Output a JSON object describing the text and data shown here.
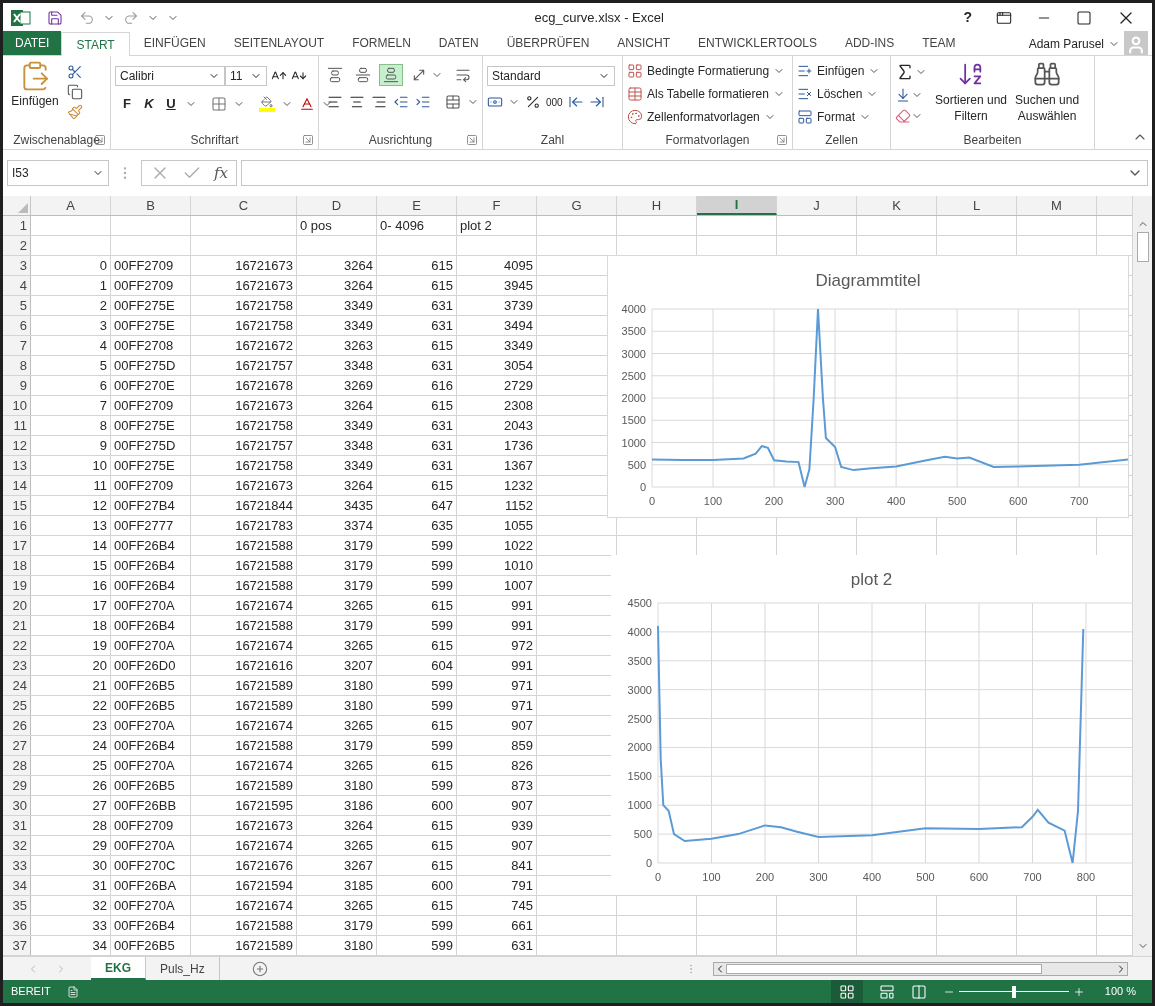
{
  "title_bar": {
    "title": "ecg_curve.xlsx - Excel",
    "help": "?"
  },
  "ribbon_tabs": [
    {
      "label": "DATEI",
      "kind": "file",
      "selected": false
    },
    {
      "label": "START",
      "kind": "tab",
      "selected": true
    },
    {
      "label": "EINFÜGEN",
      "kind": "tab",
      "selected": false
    },
    {
      "label": "SEITENLAYOUT",
      "kind": "tab",
      "selected": false
    },
    {
      "label": "FORMELN",
      "kind": "tab",
      "selected": false
    },
    {
      "label": "DATEN",
      "kind": "tab",
      "selected": false
    },
    {
      "label": "ÜBERPRÜFEN",
      "kind": "tab",
      "selected": false
    },
    {
      "label": "ANSICHT",
      "kind": "tab",
      "selected": false
    },
    {
      "label": "ENTWICKLERTOOLS",
      "kind": "tab",
      "selected": false
    },
    {
      "label": "ADD-INS",
      "kind": "tab",
      "selected": false
    },
    {
      "label": "TEAM",
      "kind": "tab",
      "selected": false
    }
  ],
  "user": {
    "name": "Adam Parusel"
  },
  "ribbon": {
    "clipboard": {
      "paste": "Einfügen",
      "label": "Zwischenablage"
    },
    "font": {
      "name": "Calibri",
      "size": "11",
      "bold": "F",
      "italic": "K",
      "underline": "U",
      "label": "Schriftart"
    },
    "alignment": {
      "vertical": [
        {
          "kind": "top",
          "selected": false
        },
        {
          "kind": "middle",
          "selected": false
        },
        {
          "kind": "bottom",
          "selected": true
        }
      ],
      "label": "Ausrichtung"
    },
    "number": {
      "format": "Standard",
      "thousands": "000",
      "label": "Zahl"
    },
    "styles": {
      "items": [
        "Bedingte Formatierung",
        "Als Tabelle formatieren",
        "Zellenformatvorlagen"
      ],
      "label": "Formatvorlagen"
    },
    "cells": {
      "items": [
        "Einfügen",
        "Löschen",
        "Format"
      ],
      "label": "Zellen"
    },
    "editing": {
      "sort": [
        "Sortieren und",
        "Filtern"
      ],
      "find": [
        "Suchen und",
        "Auswählen"
      ],
      "label": "Bearbeiten"
    }
  },
  "formula_bar": {
    "name_box": "I53",
    "fx": "fx"
  },
  "sheet": {
    "columns": [
      {
        "label": "A",
        "selected": false
      },
      {
        "label": "B",
        "selected": false
      },
      {
        "label": "C",
        "selected": false
      },
      {
        "label": "D",
        "selected": false
      },
      {
        "label": "E",
        "selected": false
      },
      {
        "label": "F",
        "selected": false
      },
      {
        "label": "G",
        "selected": false
      },
      {
        "label": "H",
        "selected": false
      },
      {
        "label": "I",
        "selected": true
      },
      {
        "label": "J",
        "selected": false
      },
      {
        "label": "K",
        "selected": false
      },
      {
        "label": "L",
        "selected": false
      },
      {
        "label": "M",
        "selected": false
      }
    ],
    "rows": [
      {
        "number": "1",
        "kind": "labels",
        "column_d": "0 pos",
        "column_e": "0- 4096",
        "column_f": "plot 2"
      },
      {
        "number": "2",
        "kind": "empty"
      },
      {
        "number": "3",
        "kind": "data",
        "cells": [
          "0",
          "00FF2709",
          "16721673",
          "3264",
          "615",
          "4095"
        ]
      },
      {
        "number": "4",
        "kind": "data",
        "cells": [
          "1",
          "00FF2709",
          "16721673",
          "3264",
          "615",
          "3945"
        ]
      },
      {
        "number": "5",
        "kind": "data",
        "cells": [
          "2",
          "00FF275E",
          "16721758",
          "3349",
          "631",
          "3739"
        ]
      },
      {
        "number": "6",
        "kind": "data",
        "cells": [
          "3",
          "00FF275E",
          "16721758",
          "3349",
          "631",
          "3494"
        ]
      },
      {
        "number": "7",
        "kind": "data",
        "cells": [
          "4",
          "00FF2708",
          "16721672",
          "3263",
          "615",
          "3349"
        ]
      },
      {
        "number": "8",
        "kind": "data",
        "cells": [
          "5",
          "00FF275D",
          "16721757",
          "3348",
          "631",
          "3054"
        ]
      },
      {
        "number": "9",
        "kind": "data",
        "cells": [
          "6",
          "00FF270E",
          "16721678",
          "3269",
          "616",
          "2729"
        ]
      },
      {
        "number": "10",
        "kind": "data",
        "cells": [
          "7",
          "00FF2709",
          "16721673",
          "3264",
          "615",
          "2308"
        ]
      },
      {
        "number": "11",
        "kind": "data",
        "cells": [
          "8",
          "00FF275E",
          "16721758",
          "3349",
          "631",
          "2043"
        ]
      },
      {
        "number": "12",
        "kind": "data",
        "cells": [
          "9",
          "00FF275D",
          "16721757",
          "3348",
          "631",
          "1736"
        ]
      },
      {
        "number": "13",
        "kind": "data",
        "cells": [
          "10",
          "00FF275E",
          "16721758",
          "3349",
          "631",
          "1367"
        ]
      },
      {
        "number": "14",
        "kind": "data",
        "cells": [
          "11",
          "00FF2709",
          "16721673",
          "3264",
          "615",
          "1232"
        ]
      },
      {
        "number": "15",
        "kind": "data",
        "cells": [
          "12",
          "00FF27B4",
          "16721844",
          "3435",
          "647",
          "1152"
        ]
      },
      {
        "number": "16",
        "kind": "data",
        "cells": [
          "13",
          "00FF2777",
          "16721783",
          "3374",
          "635",
          "1055"
        ]
      },
      {
        "number": "17",
        "kind": "data",
        "cells": [
          "14",
          "00FF26B4",
          "16721588",
          "3179",
          "599",
          "1022"
        ]
      },
      {
        "number": "18",
        "kind": "data",
        "cells": [
          "15",
          "00FF26B4",
          "16721588",
          "3179",
          "599",
          "1010"
        ]
      },
      {
        "number": "19",
        "kind": "data",
        "cells": [
          "16",
          "00FF26B4",
          "16721588",
          "3179",
          "599",
          "1007"
        ]
      },
      {
        "number": "20",
        "kind": "data",
        "cells": [
          "17",
          "00FF270A",
          "16721674",
          "3265",
          "615",
          "991"
        ]
      },
      {
        "number": "21",
        "kind": "data",
        "cells": [
          "18",
          "00FF26B4",
          "16721588",
          "3179",
          "599",
          "991"
        ]
      },
      {
        "number": "22",
        "kind": "data",
        "cells": [
          "19",
          "00FF270A",
          "16721674",
          "3265",
          "615",
          "972"
        ]
      },
      {
        "number": "23",
        "kind": "data",
        "cells": [
          "20",
          "00FF26D0",
          "16721616",
          "3207",
          "604",
          "991"
        ]
      },
      {
        "number": "24",
        "kind": "data",
        "cells": [
          "21",
          "00FF26B5",
          "16721589",
          "3180",
          "599",
          "971"
        ]
      },
      {
        "number": "25",
        "kind": "data",
        "cells": [
          "22",
          "00FF26B5",
          "16721589",
          "3180",
          "599",
          "971"
        ]
      },
      {
        "number": "26",
        "kind": "data",
        "cells": [
          "23",
          "00FF270A",
          "16721674",
          "3265",
          "615",
          "907"
        ]
      },
      {
        "number": "27",
        "kind": "data",
        "cells": [
          "24",
          "00FF26B4",
          "16721588",
          "3179",
          "599",
          "859"
        ]
      },
      {
        "number": "28",
        "kind": "data",
        "cells": [
          "25",
          "00FF270A",
          "16721674",
          "3265",
          "615",
          "826"
        ]
      },
      {
        "number": "29",
        "kind": "data",
        "cells": [
          "26",
          "00FF26B5",
          "16721589",
          "3180",
          "599",
          "873"
        ]
      },
      {
        "number": "30",
        "kind": "data",
        "cells": [
          "27",
          "00FF26BB",
          "16721595",
          "3186",
          "600",
          "907"
        ]
      },
      {
        "number": "31",
        "kind": "data",
        "cells": [
          "28",
          "00FF2709",
          "16721673",
          "3264",
          "615",
          "939"
        ]
      },
      {
        "number": "32",
        "kind": "data",
        "cells": [
          "29",
          "00FF270A",
          "16721674",
          "3265",
          "615",
          "907"
        ]
      },
      {
        "number": "33",
        "kind": "data",
        "cells": [
          "30",
          "00FF270C",
          "16721676",
          "3267",
          "615",
          "841"
        ]
      },
      {
        "number": "34",
        "kind": "data",
        "cells": [
          "31",
          "00FF26BA",
          "16721594",
          "3185",
          "600",
          "791"
        ]
      },
      {
        "number": "35",
        "kind": "data",
        "cells": [
          "32",
          "00FF270A",
          "16721674",
          "3265",
          "615",
          "745"
        ]
      },
      {
        "number": "36",
        "kind": "data",
        "cells": [
          "33",
          "00FF26B4",
          "16721588",
          "3179",
          "599",
          "661"
        ]
      },
      {
        "number": "37",
        "kind": "data",
        "cells": [
          "34",
          "00FF26B5",
          "16721589",
          "3180",
          "599",
          "631"
        ]
      }
    ],
    "charts": [
      {
        "chart_data": {
          "type": "line",
          "title": "Diagrammtitel",
          "grid": true,
          "xlim": [
            0,
            780
          ],
          "ylim": [
            0,
            4000
          ],
          "xticks": [
            0,
            100,
            200,
            300,
            400,
            500,
            600,
            700
          ],
          "yticks": [
            0,
            500,
            1000,
            1500,
            2000,
            2500,
            3000,
            3500,
            4000
          ],
          "x": [
            0,
            50,
            100,
            150,
            170,
            180,
            190,
            200,
            220,
            240,
            250,
            258,
            265,
            272,
            280,
            285,
            300,
            310,
            330,
            360,
            400,
            450,
            480,
            500,
            520,
            560,
            600,
            700,
            780
          ],
          "series": [
            {
              "color": "#5b9bd5",
              "values": [
                620,
                610,
                610,
                640,
                750,
                920,
                880,
                600,
                570,
                560,
                0,
                400,
                2000,
                4000,
                2000,
                1100,
                900,
                450,
                380,
                420,
                460,
                600,
                680,
                640,
                660,
                450,
                460,
                500,
                620
              ]
            }
          ]
        }
      },
      {
        "chart_data": {
          "type": "line",
          "title": "plot 2",
          "grid": true,
          "xlim": [
            0,
            886
          ],
          "ylim": [
            0,
            4500
          ],
          "xticks": [
            0,
            100,
            200,
            300,
            400,
            500,
            600,
            700,
            800
          ],
          "yticks": [
            0,
            500,
            1000,
            1500,
            2000,
            2500,
            3000,
            3500,
            4000,
            4500
          ],
          "x": [
            0,
            5,
            10,
            20,
            30,
            50,
            100,
            150,
            200,
            230,
            260,
            300,
            400,
            500,
            600,
            680,
            700,
            710,
            730,
            760,
            775,
            785,
            795
          ],
          "series": [
            {
              "color": "#5b9bd5",
              "values": [
                4100,
                1800,
                1000,
                900,
                500,
                380,
                420,
                500,
                650,
                620,
                540,
                450,
                480,
                600,
                590,
                620,
                800,
                920,
                700,
                560,
                0,
                900,
                4050
              ]
            }
          ]
        }
      }
    ]
  },
  "sheet_tabs": [
    {
      "label": "EKG",
      "selected": true
    },
    {
      "label": "Puls_Hz",
      "selected": false
    }
  ],
  "status_bar": {
    "status": "BEREIT",
    "zoom": "100 %",
    "zoom_slider": {
      "level": 0.5
    }
  }
}
